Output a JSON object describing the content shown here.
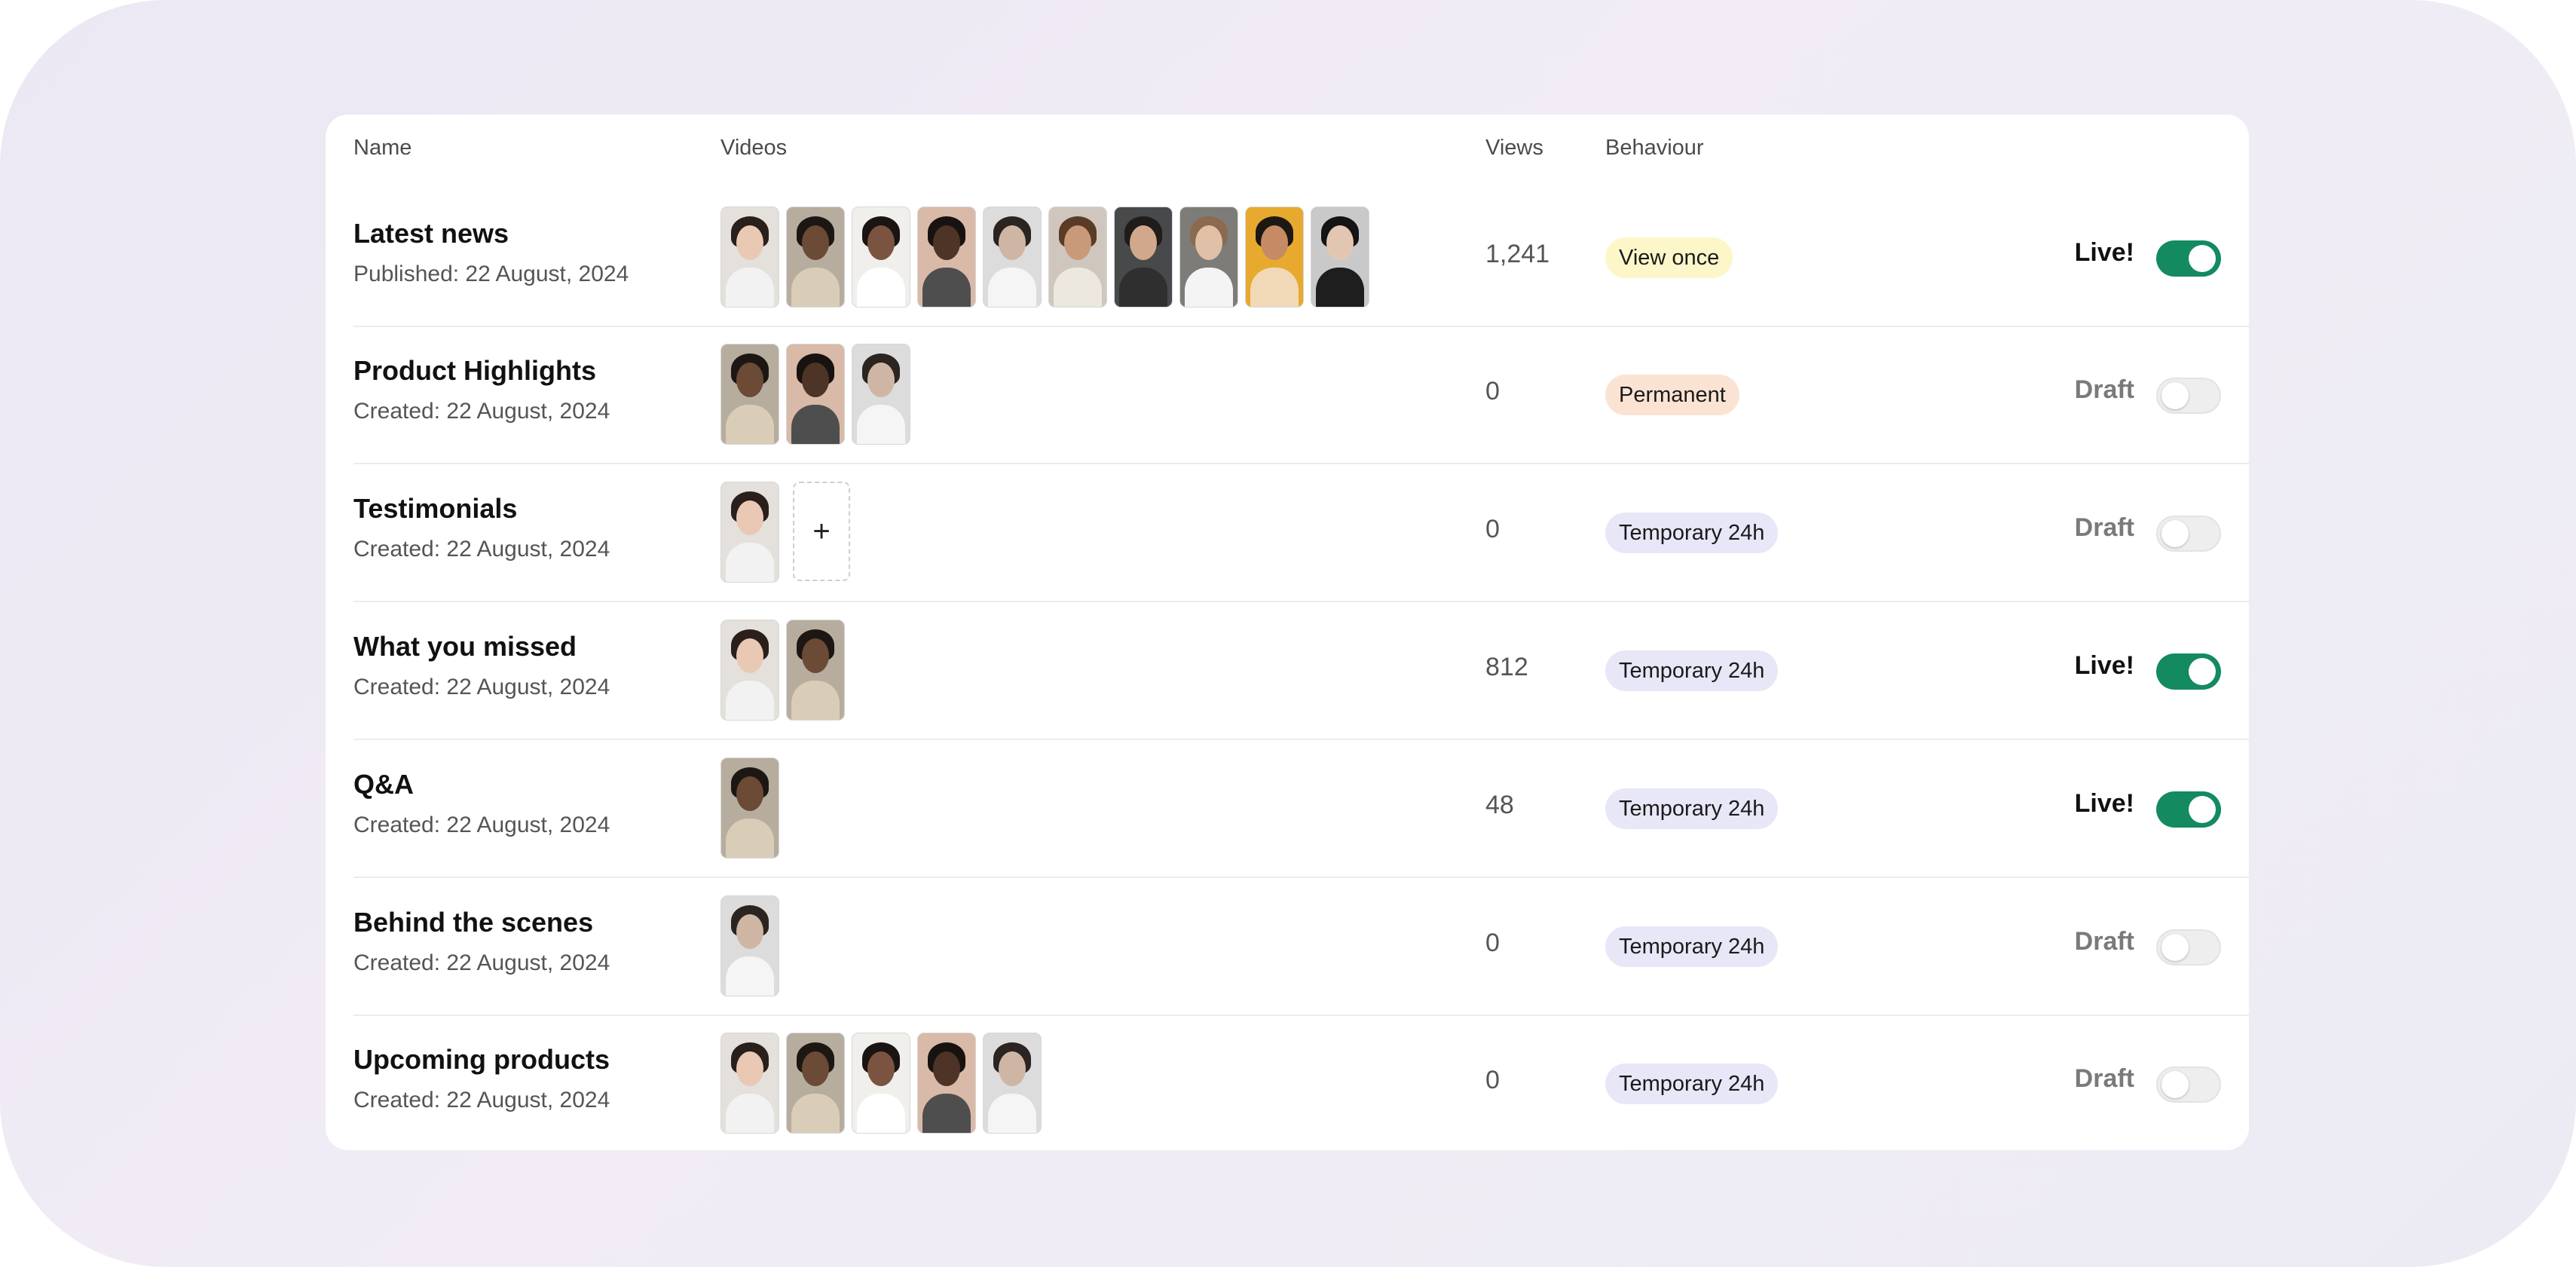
{
  "header": {
    "name": "Name",
    "videos": "Videos",
    "views": "Views",
    "behaviour": "Behaviour"
  },
  "colors": {
    "accent": "#138a5f",
    "badge_view_once": "#fdf6c9",
    "badge_permanent": "#fbe3d3",
    "badge_temporary": "#e8e7f8"
  },
  "rows": [
    {
      "title": "Latest news",
      "subtitle": "Published: 22 August, 2024",
      "views": "1,241",
      "behaviour": "View once",
      "status": "Live!",
      "live": true,
      "video_count": 10
    },
    {
      "title": "Product Highlights",
      "subtitle": "Created: 22 August, 2024",
      "views": "0",
      "behaviour": "Permanent",
      "status": "Draft",
      "live": false,
      "video_count": 3
    },
    {
      "title": "Testimonials",
      "subtitle": "Created: 22 August, 2024",
      "views": "0",
      "behaviour": "Temporary 24h",
      "status": "Draft",
      "live": false,
      "video_count": 1,
      "add_label": "+"
    },
    {
      "title": "What you missed",
      "subtitle": "Created: 22 August, 2024",
      "views": "812",
      "behaviour": "Temporary 24h",
      "status": "Live!",
      "live": true,
      "video_count": 2
    },
    {
      "title": "Q&A",
      "subtitle": "Created: 22 August, 2024",
      "views": "48",
      "behaviour": "Temporary 24h",
      "status": "Live!",
      "live": true,
      "video_count": 1
    },
    {
      "title": "Behind the scenes",
      "subtitle": "Created: 22 August, 2024",
      "views": "0",
      "behaviour": "Temporary 24h",
      "status": "Draft",
      "live": false,
      "video_count": 1
    },
    {
      "title": "Upcoming products",
      "subtitle": "Created: 22 August, 2024",
      "views": "0",
      "behaviour": "Temporary 24h",
      "status": "Draft",
      "live": false,
      "video_count": 5
    }
  ]
}
